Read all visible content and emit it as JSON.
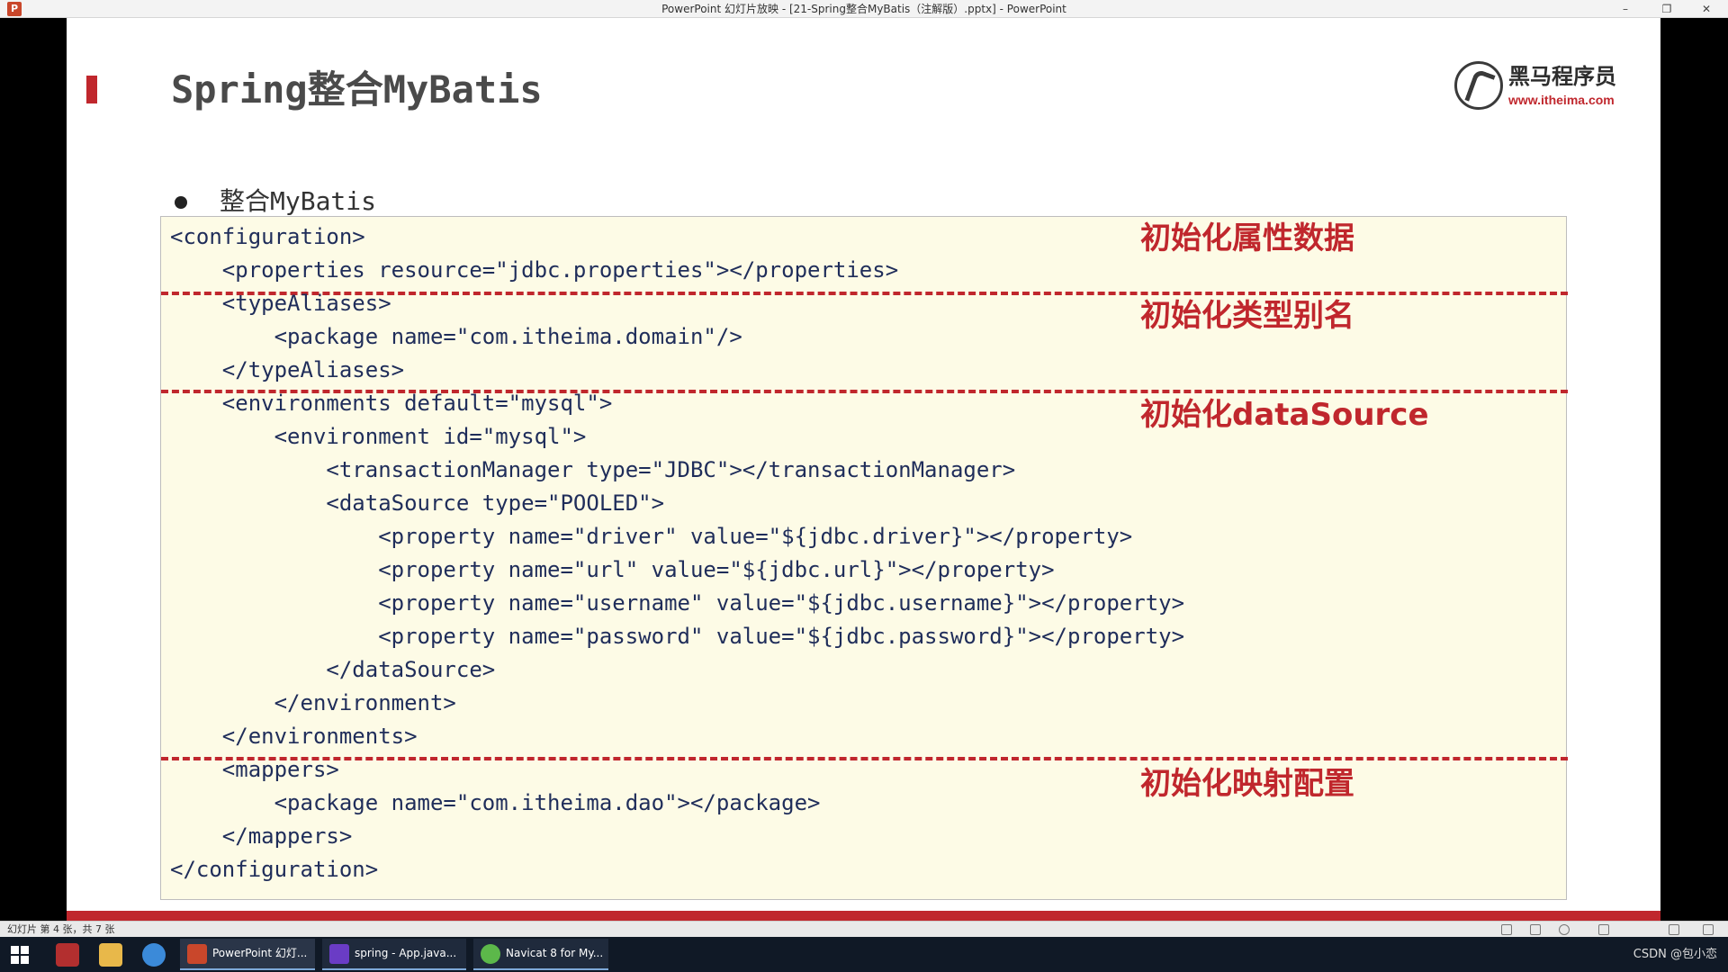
{
  "window": {
    "title": "PowerPoint 幻灯片放映 - [21-Spring整合MyBatis（注解版）.pptx] - PowerPoint",
    "minimize": "–",
    "restore": "❐",
    "close": "✕"
  },
  "slide": {
    "title": "Spring整合MyBatis",
    "logo_text": "黑马程序员",
    "logo_url": "www.itheima.com",
    "bullet": "整合MyBatis",
    "code_lines": [
      "<configuration>",
      "    <properties resource=\"jdbc.properties\"></properties>",
      "    <typeAliases>",
      "        <package name=\"com.itheima.domain\"/>",
      "    </typeAliases>",
      "    <environments default=\"mysql\">",
      "        <environment id=\"mysql\">",
      "            <transactionManager type=\"JDBC\"></transactionManager>",
      "            <dataSource type=\"POOLED\">",
      "                <property name=\"driver\" value=\"${jdbc.driver}\"></property>",
      "                <property name=\"url\" value=\"${jdbc.url}\"></property>",
      "                <property name=\"username\" value=\"${jdbc.username}\"></property>",
      "                <property name=\"password\" value=\"${jdbc.password}\"></property>",
      "            </dataSource>",
      "        </environment>",
      "    </environments>",
      "    <mappers>",
      "        <package name=\"com.itheima.dao\"></package>",
      "    </mappers>",
      "</configuration>"
    ],
    "annotations": {
      "properties": "初始化属性数据",
      "aliases": "初始化类型别名",
      "datasource": "初始化dataSource",
      "mappers": "初始化映射配置"
    },
    "accent_color": "#c0272d"
  },
  "statusbar": {
    "text": "幻灯片 第 4 张，共 7 张"
  },
  "taskbar": {
    "items": [
      "PowerPoint 幻灯...",
      "spring - App.java...",
      "Navicat 8 for My..."
    ],
    "tray": "CSDN @包小恋"
  }
}
